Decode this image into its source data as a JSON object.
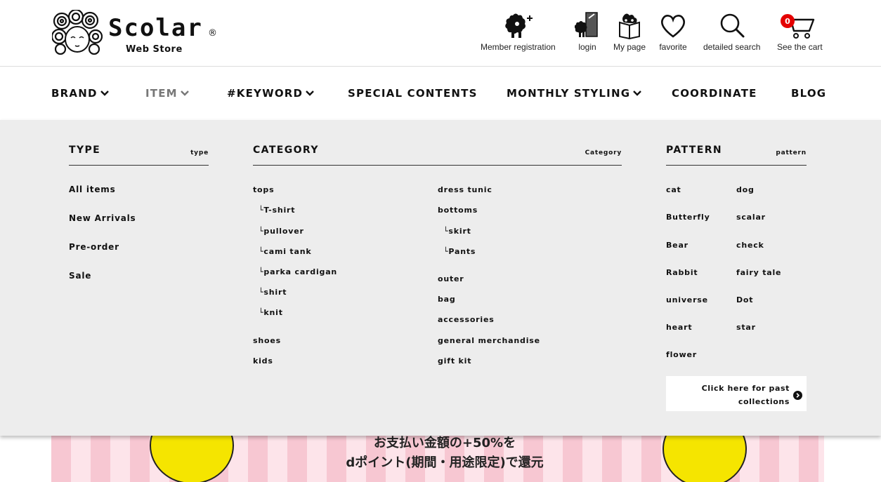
{
  "logo": {
    "word": "Scolar",
    "reg": "®",
    "sub": "Web Store"
  },
  "utility": [
    {
      "label": "Member registration",
      "icon": "member-registration-icon"
    },
    {
      "label": "login",
      "icon": "login-icon"
    },
    {
      "label": "My page",
      "icon": "my-page-icon"
    },
    {
      "label": "favorite",
      "icon": "heart-icon"
    },
    {
      "label": "detailed search",
      "icon": "search-icon"
    },
    {
      "label": "See the cart",
      "icon": "cart-icon",
      "badge": "0"
    }
  ],
  "nav": [
    "BRAND",
    "ITEM",
    "#KEYWORD",
    "SPECIAL CONTENTS",
    "MONTHLY STYLING",
    "COORDINATE",
    "BLOG"
  ],
  "mega": {
    "type": {
      "title": "TYPE",
      "sub": "type",
      "items": [
        "All items",
        "New Arrivals",
        "Pre-order",
        "Sale"
      ]
    },
    "category": {
      "title": "CATEGORY",
      "sub": "Category",
      "col1": [
        "tops",
        "└T-shirt",
        "└pullover",
        "└cami tank",
        "└parka cardigan",
        "└shirt",
        "└knit",
        "shoes",
        "kids"
      ],
      "col2": [
        "dress tunic",
        "bottoms",
        "└skirt",
        "└Pants",
        "outer",
        "bag",
        "accessories",
        "general merchandise",
        "gift kit"
      ]
    },
    "pattern": {
      "title": "PATTERN",
      "sub": "pattern",
      "col1": [
        "cat",
        "Butterfly",
        "Bear",
        "Rabbit",
        "universe",
        "heart",
        "flower"
      ],
      "col2": [
        "dog",
        "scalar",
        "check",
        "fairy tale",
        "Dot",
        "star"
      ]
    },
    "past_link": "Click here for past collections"
  },
  "banner": {
    "line1": "お支払い金額の+50%を",
    "line2": "dポイント(期間・用途限定)で還元"
  },
  "colors": {
    "badge": "#e40000",
    "menu_bg": "#ededed",
    "active_nav": "#777777"
  }
}
